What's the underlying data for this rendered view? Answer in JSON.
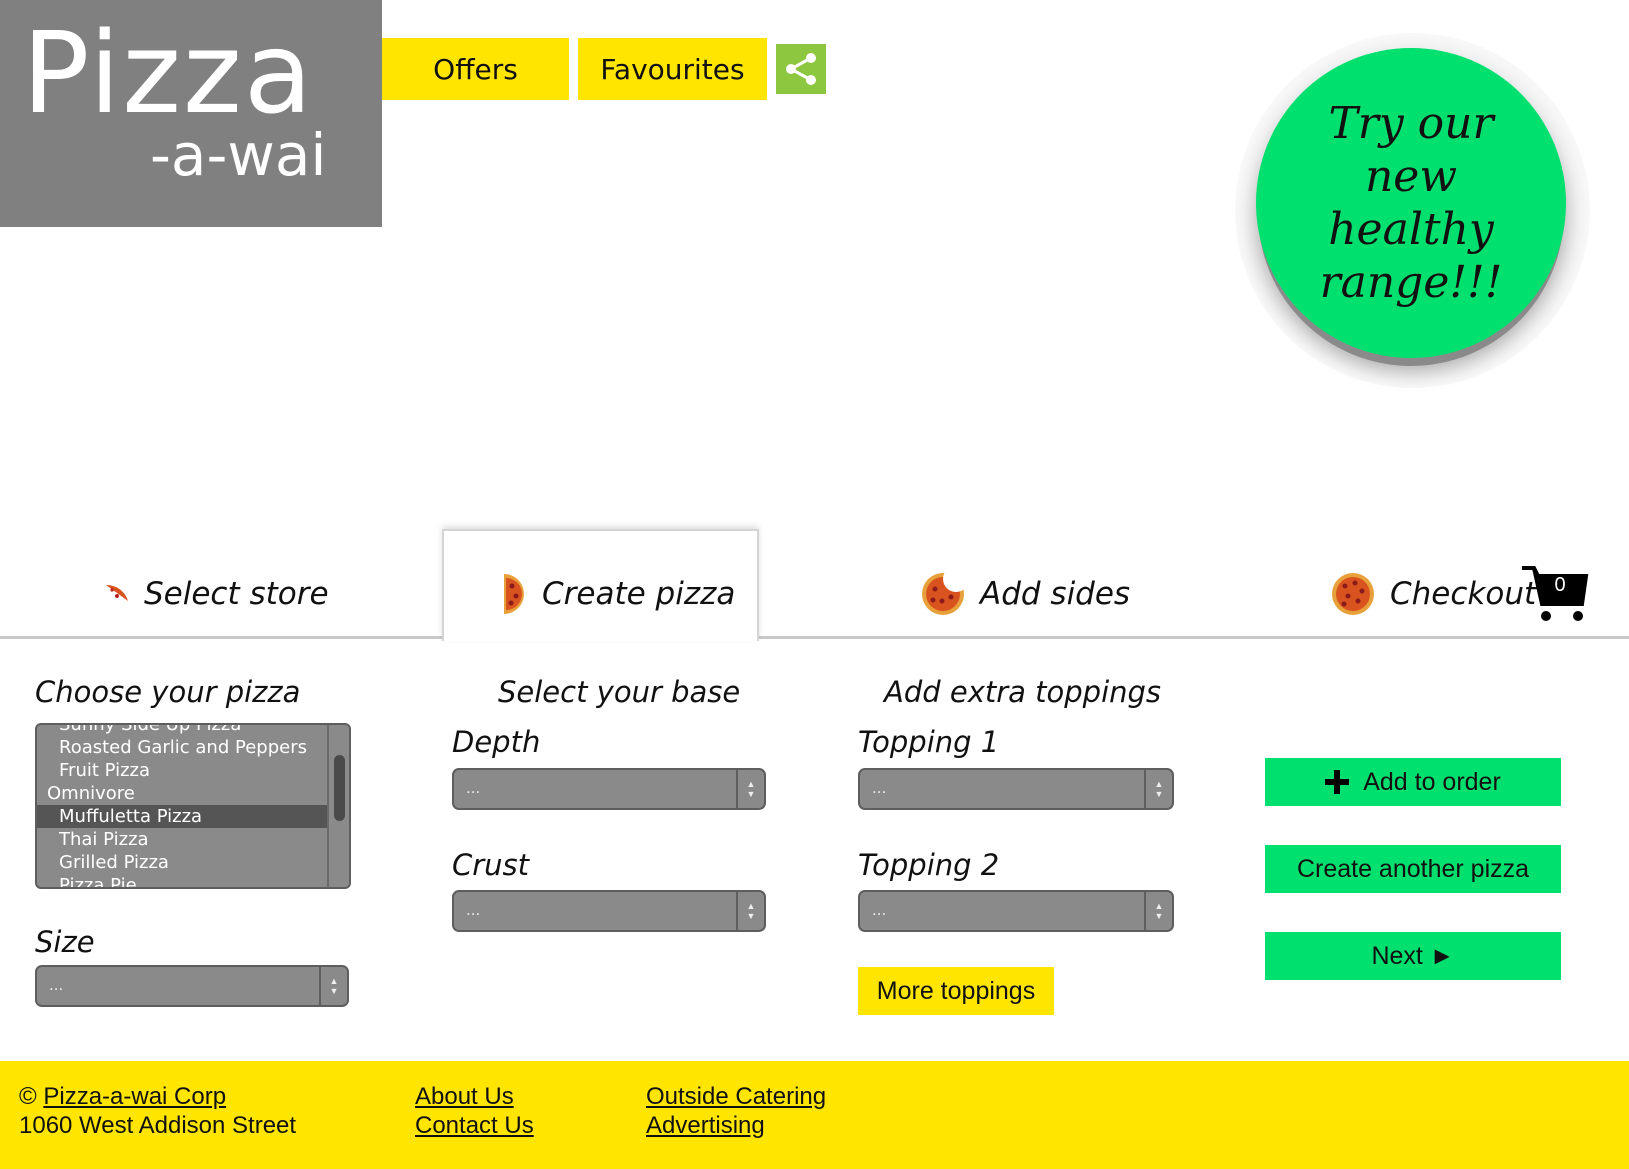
{
  "logo": {
    "line1": "Pizza",
    "line2": "-a-wai"
  },
  "nav": {
    "offers": "Offers",
    "favourites": "Favourites"
  },
  "promo": {
    "text": "Try our new healthy range!!!"
  },
  "tabs": [
    {
      "label": "Select store"
    },
    {
      "label": "Create pizza"
    },
    {
      "label": "Add sides"
    },
    {
      "label": "Checkout"
    }
  ],
  "cart": {
    "count": "0"
  },
  "choose": {
    "heading": "Choose your pizza",
    "items": [
      "Sunny Side Up Pizza",
      "Roasted Garlic and Peppers",
      "Fruit Pizza",
      "Omnivore",
      "Muffuletta Pizza",
      "Thai Pizza",
      "Grilled Pizza",
      "Pizza Pie"
    ],
    "selected": "Muffuletta Pizza",
    "size_label": "Size",
    "size_value": "..."
  },
  "base": {
    "heading": "Select your base",
    "depth_label": "Depth",
    "depth_value": "...",
    "crust_label": "Crust",
    "crust_value": "..."
  },
  "toppings": {
    "heading": "Add extra toppings",
    "t1_label": "Topping 1",
    "t1_value": "...",
    "t2_label": "Topping 2",
    "t2_value": "...",
    "more": "More toppings"
  },
  "actions": {
    "add": "Add to order",
    "another": "Create another pizza",
    "next": "Next ►"
  },
  "footer": {
    "copyright": "©",
    "corp": "Pizza-a-wai Corp",
    "address": "1060 West Addison Street",
    "about": "About Us",
    "contact": "Contact Us",
    "catering": "Outside Catering",
    "advertising": "Advertising"
  },
  "colors": {
    "accent_yellow": "#FFE500",
    "accent_green": "#00E06E",
    "logo_gray": "#808080"
  }
}
